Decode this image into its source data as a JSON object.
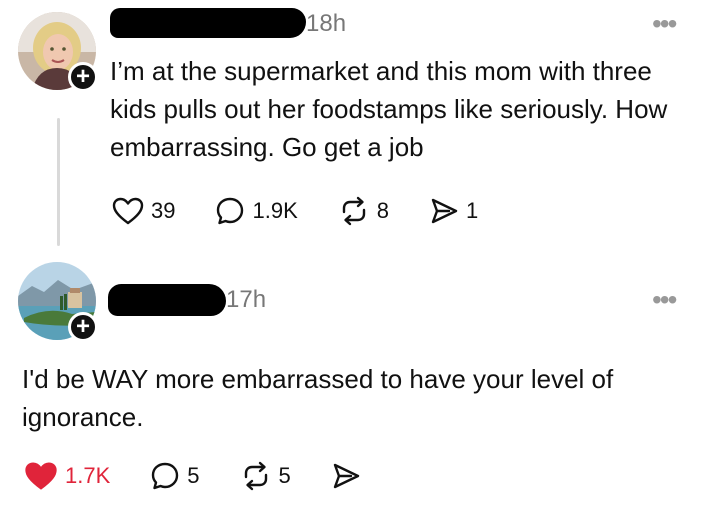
{
  "post1": {
    "time": "18h",
    "text": "I’m at the supermarket and this mom with three kids pulls out her foodstamps like seriously. How embarrassing. Go get a job",
    "likes": "39",
    "replies": "1.9K",
    "reposts": "8",
    "shares": "1",
    "follow_glyph": "+",
    "more_glyph": "•••"
  },
  "post2": {
    "time": "17h",
    "text": "I'd be WAY more embarrassed to have your level of ignorance.",
    "likes": "1.7K",
    "replies": "5",
    "reposts": "5",
    "follow_glyph": "+",
    "more_glyph": "•••",
    "liked": true,
    "like_color": "#e0243a"
  }
}
